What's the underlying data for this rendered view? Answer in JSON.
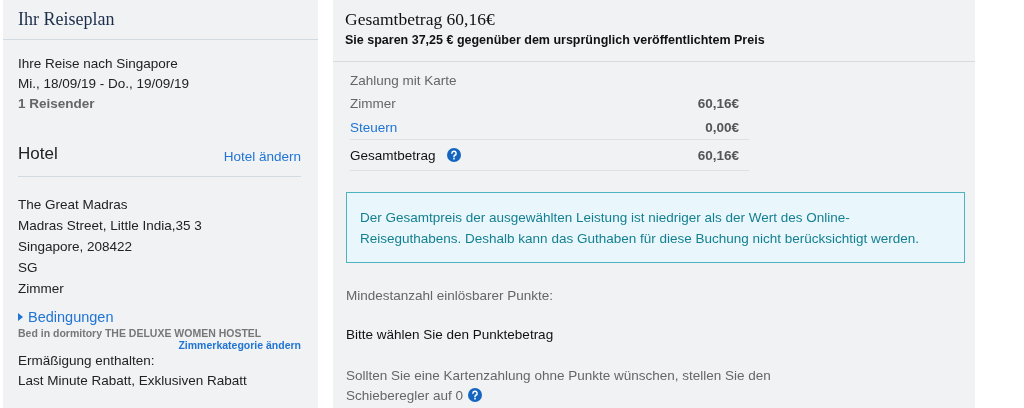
{
  "itinerary": {
    "title": "Ihr Reiseplan",
    "trip": {
      "destination": "Ihre Reise nach Singapore",
      "dates": "Mi., 18/09/19 - Do., 19/09/19",
      "travelers": "1 Reisender"
    },
    "hotel": {
      "heading": "Hotel",
      "change_link": "Hotel ändern",
      "address": [
        "The Great Madras",
        "Madras Street, Little India,35 3",
        "Singapore, 208422",
        "SG"
      ],
      "room": "Zimmer",
      "conditions": {
        "label": "Bedingungen",
        "expanded": false
      },
      "room_type": "Bed in dormitory THE DELUXE WOMEN HOSTEL",
      "room_change_link": "Zimmerkategorie ändern",
      "discount_label": "Ermäßigung enthalten:",
      "discounts": "Last Minute Rabatt, Exklusiven Rabatt"
    }
  },
  "summary": {
    "title": "Gesamtbetrag 60,16€",
    "savings": "Sie sparen 37,25 € gegenüber dem ursprünglich veröffentlichtem Preis",
    "payment_label": "Zahlung mit Karte",
    "rows": [
      {
        "kind": "plain",
        "label": "Zimmer",
        "amount": "60,16€"
      },
      {
        "kind": "link",
        "label": "Steuern",
        "amount": "0,00€"
      },
      {
        "kind": "total",
        "label": "Gesamtbetrag",
        "amount": "60,16€"
      }
    ],
    "notice": "Der Gesamtpreis der ausgewählten Leistung ist niedriger als der Wert des Online-Reiseguthabens. Deshalb kann das Guthaben für diese Buchung nicht berücksichtigt werden.",
    "min_points": "Mindestanzahl einlösbarer Punkte:",
    "choose_points": "Bitte wählen Sie den Punktebetrag",
    "slider_hint_lines": [
      "Sollten Sie eine Kartenzahlung ohne Punkte wünschen, stellen Sie den",
      "Schieberegler auf 0"
    ]
  }
}
